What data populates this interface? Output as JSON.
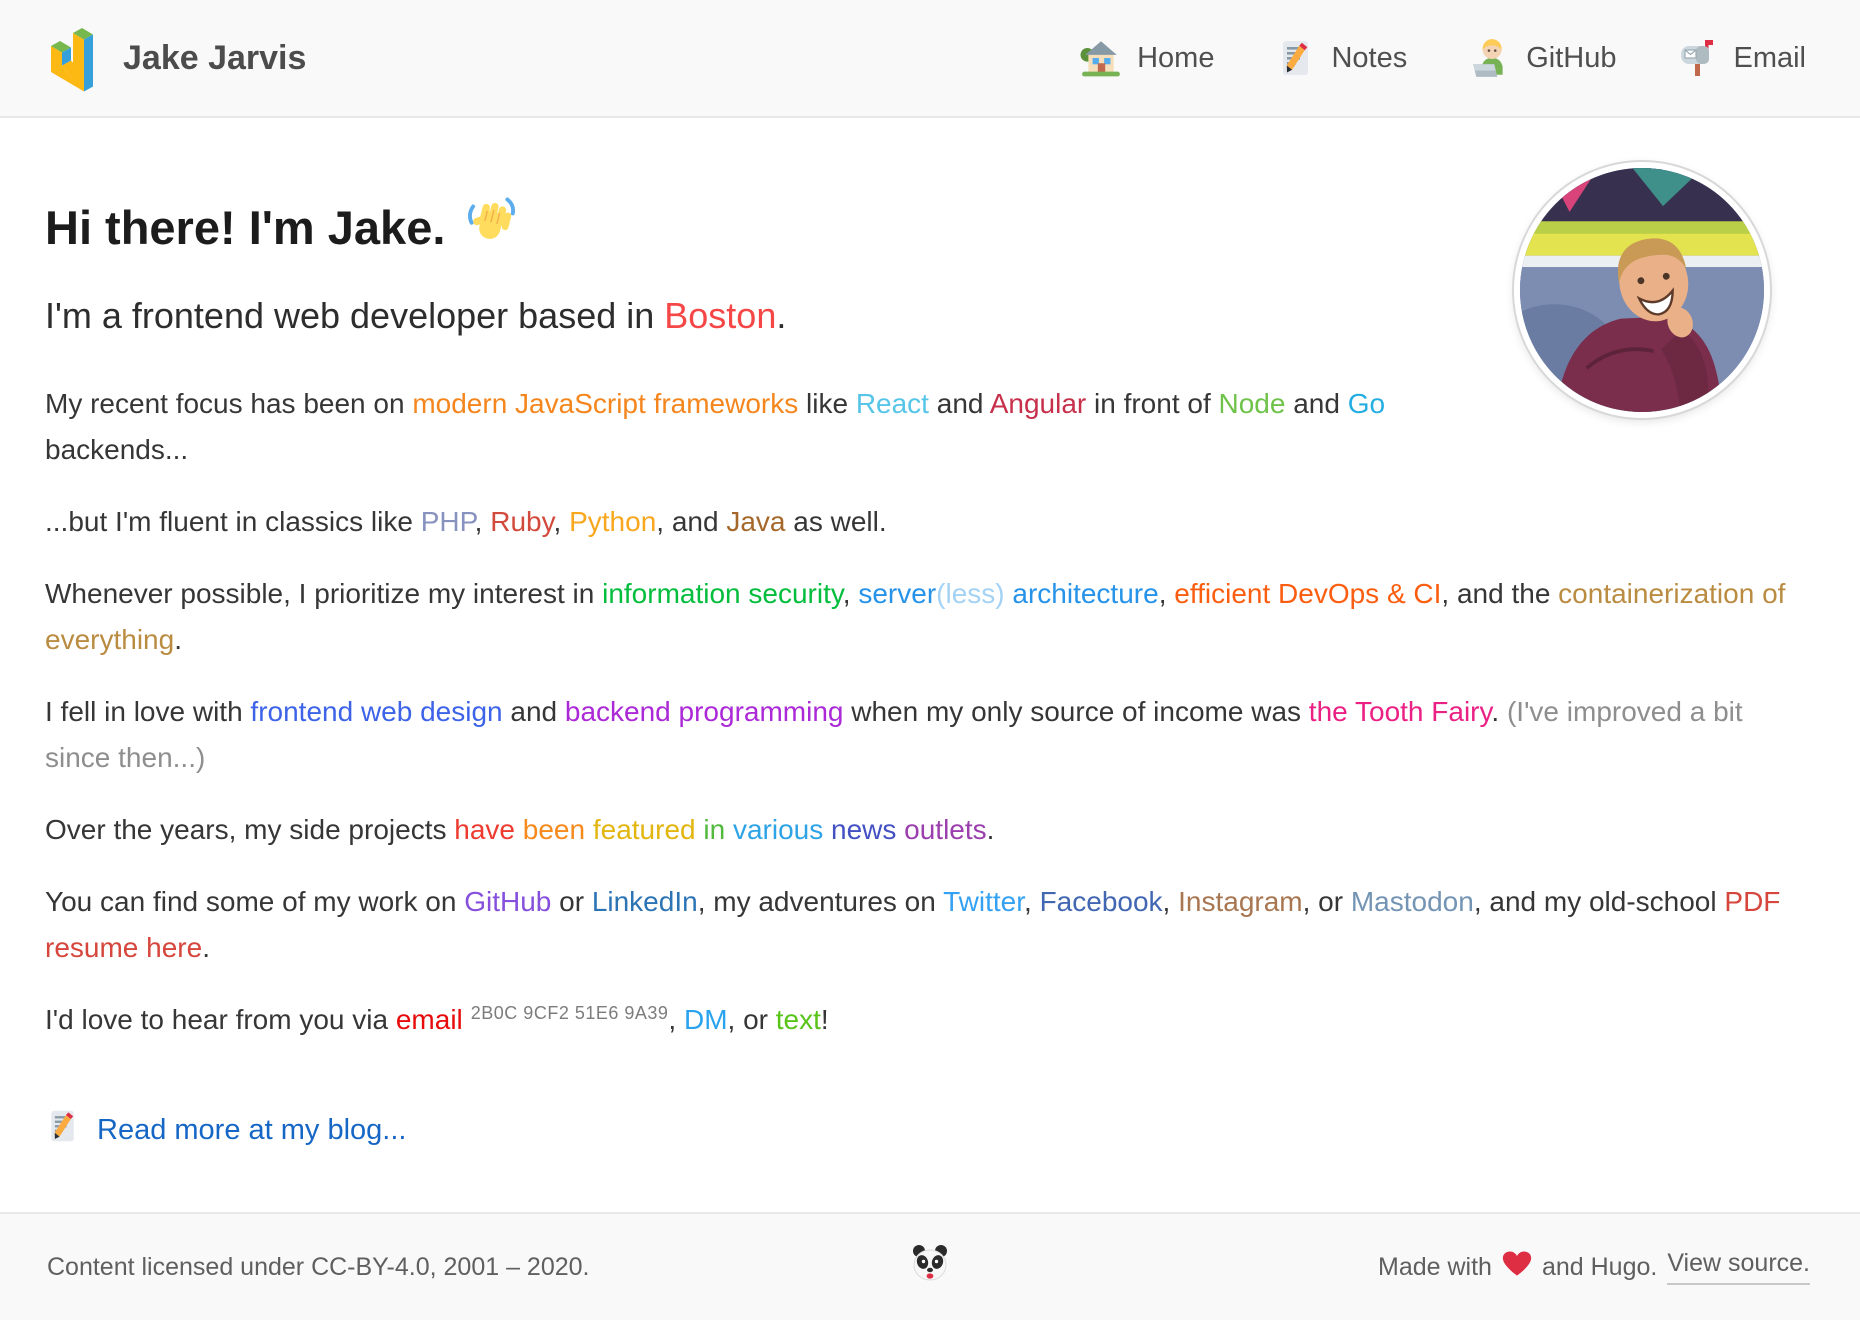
{
  "header": {
    "site_title": "Jake Jarvis",
    "nav": [
      {
        "icon": "house-icon",
        "label": "Home"
      },
      {
        "icon": "memo-icon",
        "label": "Notes"
      },
      {
        "icon": "technologist-icon",
        "label": "GitHub"
      },
      {
        "icon": "mailbox-icon",
        "label": "Email"
      }
    ]
  },
  "main": {
    "heading": "Hi there! I'm Jake.",
    "wave_icon": "waving-hand-icon",
    "subheading": [
      {
        "t": "I'm a frontend web developer based in "
      },
      {
        "t": "Boston",
        "c": "#f64747",
        "link": true,
        "name": "boston-link"
      },
      {
        "t": "."
      }
    ],
    "paragraphs": [
      [
        {
          "t": "My recent focus has been on "
        },
        {
          "t": "modern JavaScript frameworks",
          "c": "#f4861d",
          "link": true,
          "name": "js-frameworks-link"
        },
        {
          "t": " like "
        },
        {
          "t": "React",
          "c": "#56c5e8",
          "link": true,
          "name": "react-link"
        },
        {
          "t": " and "
        },
        {
          "t": "Angular",
          "c": "#c7304b",
          "link": true,
          "name": "angular-link"
        },
        {
          "t": " in front of "
        },
        {
          "t": "Node",
          "c": "#6fc24a",
          "link": true,
          "name": "node-link"
        },
        {
          "t": " and "
        },
        {
          "t": "Go",
          "c": "#25aee2",
          "link": true,
          "name": "go-link"
        },
        {
          "t": " backends..."
        }
      ],
      [
        {
          "t": "...but I'm fluent in classics like "
        },
        {
          "t": "PHP",
          "c": "#8892bf",
          "link": true,
          "name": "php-link"
        },
        {
          "t": ", "
        },
        {
          "t": "Ruby",
          "c": "#d24a3c",
          "link": true,
          "name": "ruby-link"
        },
        {
          "t": ", "
        },
        {
          "t": "Python",
          "c": "#f8a71e",
          "link": true,
          "name": "python-link"
        },
        {
          "t": ", and "
        },
        {
          "t": "Java",
          "c": "#a5682a",
          "link": true,
          "name": "java-link"
        },
        {
          "t": " as well."
        }
      ],
      [
        {
          "t": "Whenever possible, I prioritize my interest in "
        },
        {
          "t": "information security",
          "c": "#03bd3c",
          "link": true,
          "name": "infosec-link"
        },
        {
          "t": ", "
        },
        {
          "t": "server",
          "c": "#2793e8",
          "link": true,
          "name": "serverless-link"
        },
        {
          "t": "(less)",
          "c": "#a3d2f4",
          "link": true,
          "name": "serverless-less-link"
        },
        {
          "t": " architecture",
          "c": "#2793e8",
          "link": true,
          "name": "architecture-link"
        },
        {
          "t": ", "
        },
        {
          "t": "efficient DevOps & CI",
          "c": "#fb5e11",
          "link": true,
          "name": "devops-link"
        },
        {
          "t": ", and the "
        },
        {
          "t": "containerization of everything",
          "c": "#ba8c42",
          "link": true,
          "name": "containerization-link"
        },
        {
          "t": "."
        }
      ],
      [
        {
          "t": "I fell in love with "
        },
        {
          "t": "frontend web design",
          "c": "#3d63e8",
          "link": true,
          "name": "frontend-design-link"
        },
        {
          "t": " and "
        },
        {
          "t": "backend programming",
          "c": "#ab29d6",
          "link": true,
          "name": "backend-programming-link"
        },
        {
          "t": " when my only source of income was "
        },
        {
          "t": "the Tooth Fairy",
          "c": "#eb2084",
          "link": true,
          "name": "tooth-fairy-link"
        },
        {
          "t": ". "
        },
        {
          "t": "(I've improved a bit since then...)",
          "c": "#8e8e8e",
          "name": "improved-note"
        }
      ],
      [
        {
          "t": "Over the years, my side projects "
        },
        {
          "t": "have",
          "c": "#ed3b2f",
          "link": true,
          "name": "press-link-have"
        },
        {
          "t": " "
        },
        {
          "t": "been",
          "c": "#f68a1c",
          "link": true,
          "name": "press-link-been"
        },
        {
          "t": " "
        },
        {
          "t": "featured",
          "c": "#e3b50f",
          "link": true,
          "name": "press-link-featured"
        },
        {
          "t": " "
        },
        {
          "t": "in",
          "c": "#53b83e",
          "link": true,
          "name": "press-link-in"
        },
        {
          "t": " "
        },
        {
          "t": "various",
          "c": "#2ea3e6",
          "link": true,
          "name": "press-link-various"
        },
        {
          "t": " "
        },
        {
          "t": "news",
          "c": "#4351c2",
          "link": true,
          "name": "press-link-news"
        },
        {
          "t": " "
        },
        {
          "t": "outlets",
          "c": "#9a3fad",
          "link": true,
          "name": "press-link-outlets"
        },
        {
          "t": "."
        }
      ],
      [
        {
          "t": "You can find some of my work on "
        },
        {
          "t": "GitHub",
          "c": "#8650dc",
          "link": true,
          "name": "github-link"
        },
        {
          "t": " or "
        },
        {
          "t": "LinkedIn",
          "c": "#2d74b5",
          "link": true,
          "name": "linkedin-link"
        },
        {
          "t": ", my adventures on "
        },
        {
          "t": "Twitter",
          "c": "#34a1f2",
          "link": true,
          "name": "twitter-link"
        },
        {
          "t": ", "
        },
        {
          "t": "Facebook",
          "c": "#4267b2",
          "link": true,
          "name": "facebook-link"
        },
        {
          "t": ", "
        },
        {
          "t": "Instagram",
          "c": "#a87651",
          "link": true,
          "name": "instagram-link"
        },
        {
          "t": ", or "
        },
        {
          "t": "Mastodon",
          "c": "#7494b4",
          "link": true,
          "name": "mastodon-link"
        },
        {
          "t": ", and my old-school "
        },
        {
          "t": "PDF resume here",
          "c": "#d6463c",
          "link": true,
          "name": "resume-link"
        },
        {
          "t": "."
        }
      ],
      [
        {
          "t": "I'd love to hear from you via "
        },
        {
          "t": "email",
          "c": "#e80b0b",
          "link": true,
          "name": "email-link"
        },
        {
          "t": "2B0C 9CF2 51E6 9A39",
          "sup": true,
          "name": "pgp-fingerprint"
        },
        {
          "t": ", "
        },
        {
          "t": "DM",
          "c": "#2aa3ef",
          "link": true,
          "name": "dm-link"
        },
        {
          "t": ", or "
        },
        {
          "t": "text",
          "c": "#58c417",
          "link": true,
          "name": "text-link"
        },
        {
          "t": "!"
        }
      ]
    ],
    "blog_link": "Read more at my blog..."
  },
  "footer": {
    "license": "Content licensed under CC-BY-4.0, 2001 – 2020.",
    "made_with": "Made with",
    "and_hugo": "and Hugo.",
    "view_source": "View source.",
    "panda_icon": "panda-icon",
    "heart_icon": "red-heart-icon"
  },
  "colors": {
    "header_bg": "#f9f9f9",
    "border": "#e8e8e8",
    "heading_text": "#1c1c1c",
    "body_text": "#363636",
    "blog_link_blue": "#1667c5",
    "boston_red": "#f64747",
    "heart_red": "#dd2e44",
    "logo_green": "#76b84e",
    "logo_yellow": "#fcb813",
    "logo_blue": "#36a0da"
  }
}
